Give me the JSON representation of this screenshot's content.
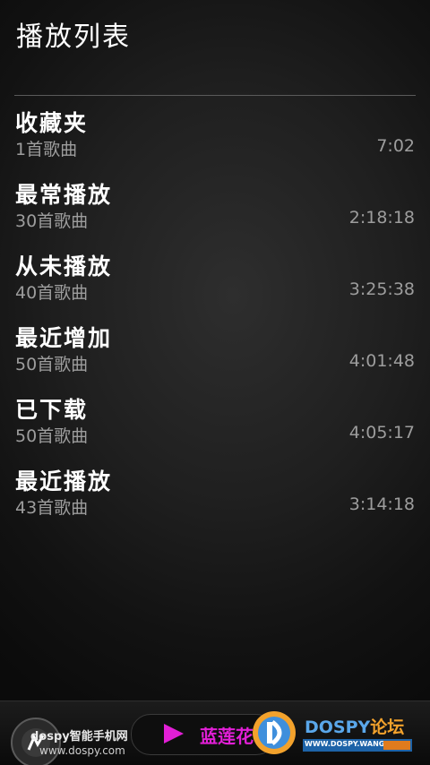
{
  "header": {
    "title": "播放列表"
  },
  "playlists": [
    {
      "name": "收藏夹",
      "count": "1首歌曲",
      "duration": "7:02"
    },
    {
      "name": "最常播放",
      "count": "30首歌曲",
      "duration": "2:18:18"
    },
    {
      "name": "从未播放",
      "count": "40首歌曲",
      "duration": "3:25:38"
    },
    {
      "name": "最近增加",
      "count": "50首歌曲",
      "duration": "4:01:48"
    },
    {
      "name": "已下载",
      "count": "50首歌曲",
      "duration": "4:05:17"
    },
    {
      "name": "最近播放",
      "count": "43首歌曲",
      "duration": "3:14:18"
    }
  ],
  "watermark": {
    "site_label": "dospy智能手机网",
    "site_url": "www.dospy.com",
    "lotus_label": "蓝莲花",
    "brand_name": "DOSPY",
    "brand_suffix": "论坛",
    "brand_url": "WWW.DOSPY.WANG"
  },
  "colors": {
    "background": "#1f1f1f",
    "primary_text": "#ffffff",
    "secondary_text": "#9d9d9d",
    "accent_magenta": "#e21fd6",
    "brand_blue": "#5aa7ea",
    "brand_orange": "#f3a22c"
  }
}
